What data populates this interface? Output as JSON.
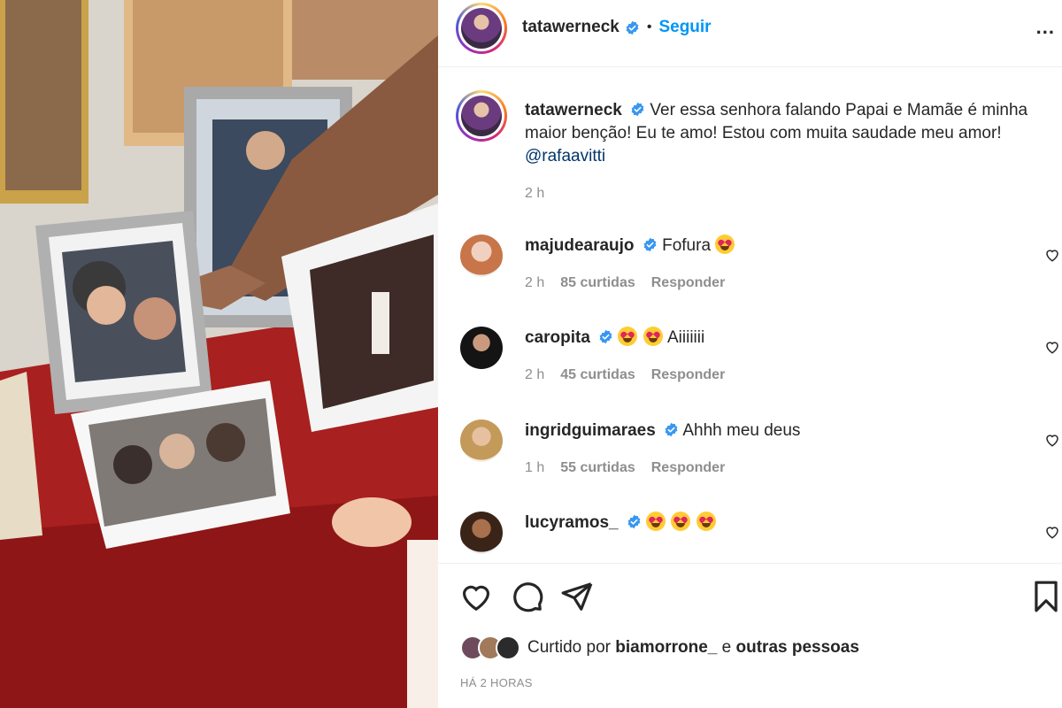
{
  "post": {
    "author": "tatawerneck",
    "separator": "•",
    "follow_label": "Seguir",
    "more_label": "..."
  },
  "caption": {
    "author": "tatawerneck",
    "text": "Ver essa senhora falando Papai e Mamãe é minha maior benção! Eu te amo! Estou com muita saudade meu amor!",
    "mention": "@rafaavitti",
    "time": "2 h"
  },
  "comments": [
    {
      "user": "majudearaujo",
      "text": "Fofura",
      "emoji_count": 1,
      "time": "2 h",
      "likes": "85 curtidas",
      "reply": "Responder"
    },
    {
      "user": "caropita",
      "text": "Aiiiiiii",
      "emoji_count": 2,
      "time": "2 h",
      "likes": "45 curtidas",
      "reply": "Responder"
    },
    {
      "user": "ingridguimaraes",
      "text": "Ahhh meu deus",
      "emoji_count": 0,
      "time": "1 h",
      "likes": "55 curtidas",
      "reply": "Responder"
    },
    {
      "user": "lucyramos_",
      "text": "",
      "emoji_count": 3
    }
  ],
  "likes": {
    "prefix": "Curtido por",
    "user": "biamorrone_",
    "connector": "e",
    "others": "outras pessoas"
  },
  "timestamp": "HÁ 2 HORAS",
  "icons": {
    "verified": "verified-badge-icon",
    "heart": "heart-icon",
    "comment": "comment-icon",
    "share": "share-icon",
    "save": "bookmark-icon"
  },
  "colors": {
    "link_blue": "#0095f6",
    "mention": "#00376b",
    "verified": "#3897f0",
    "secondary_text": "#8e8e8e"
  }
}
